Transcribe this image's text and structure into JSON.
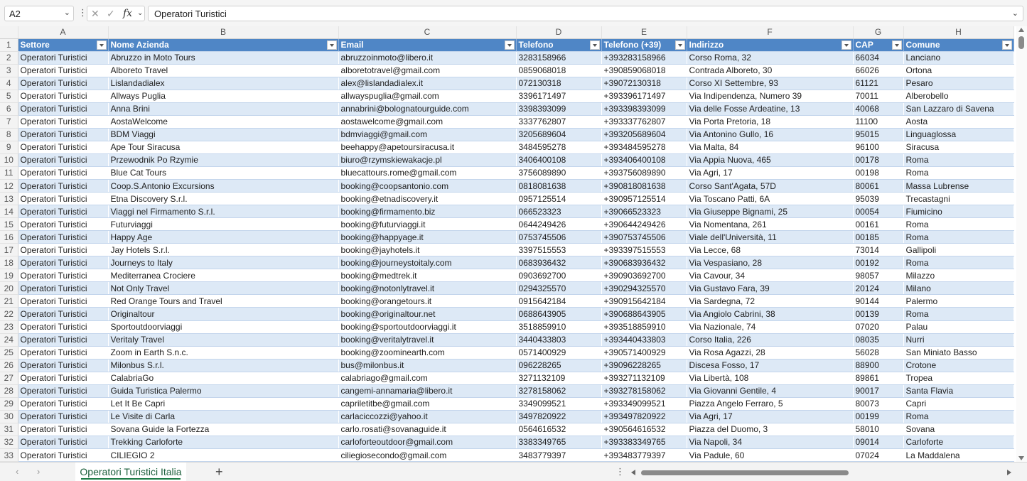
{
  "formula_bar": {
    "name_box": "A2",
    "cancel_icon": "✕",
    "enter_icon": "✓",
    "fx_label": "fx",
    "content": "Operatori Turistici"
  },
  "columns": [
    "A",
    "B",
    "C",
    "D",
    "E",
    "F",
    "G",
    "H"
  ],
  "header_row_number": "1",
  "table_headers": [
    "Settore",
    "Nome Azienda",
    "Email",
    "Telefono",
    "Telefono (+39)",
    "Indirizzo",
    "CAP",
    "Comune"
  ],
  "rows": [
    {
      "n": "2",
      "cells": [
        "Operatori Turistici",
        "Abruzzo in Moto Tours",
        "abruzzoinmoto@libero.it",
        "3283158966",
        "+393283158966",
        "Corso Roma, 32",
        "66034",
        "Lanciano"
      ]
    },
    {
      "n": "3",
      "cells": [
        "Operatori Turistici",
        "Alboreto Travel",
        "alboretotravel@gmail.com",
        "0859068018",
        "+390859068018",
        "Contrada Alboreto, 30",
        "66026",
        "Ortona"
      ]
    },
    {
      "n": "4",
      "cells": [
        "Operatori Turistici",
        "Lislandadialex",
        "alex@lislandadialex.it",
        "072130318",
        "+39072130318",
        "Corso XI Settembre, 93",
        "61121",
        "Pesaro"
      ]
    },
    {
      "n": "5",
      "cells": [
        "Operatori Turistici",
        "Allways Puglia",
        "allwayspuglia@gmail.com",
        "3396171497",
        "+393396171497",
        "Via Indipendenza, Numero 39",
        "70011",
        "Alberobello"
      ]
    },
    {
      "n": "6",
      "cells": [
        "Operatori Turistici",
        "Anna Brini",
        "annabrini@bolognatourguide.com",
        "3398393099",
        "+393398393099",
        "Via delle Fosse Ardeatine, 13",
        "40068",
        "San Lazzaro di Savena"
      ]
    },
    {
      "n": "7",
      "cells": [
        "Operatori Turistici",
        "AostaWelcome",
        "aostawelcome@gmail.com",
        "3337762807",
        "+393337762807",
        "Via Porta Pretoria, 18",
        "11100",
        "Aosta"
      ]
    },
    {
      "n": "8",
      "cells": [
        "Operatori Turistici",
        "BDM Viaggi",
        "bdmviaggi@gmail.com",
        "3205689604",
        "+393205689604",
        "Via Antonino Gullo, 16",
        "95015",
        "Linguaglossa"
      ]
    },
    {
      "n": "9",
      "cells": [
        "Operatori Turistici",
        "Ape Tour Siracusa",
        "beehappy@apetoursiracusa.it",
        "3484595278",
        "+393484595278",
        "Via Malta, 84",
        "96100",
        "Siracusa"
      ]
    },
    {
      "n": "10",
      "cells": [
        "Operatori Turistici",
        "Przewodnik Po Rzymie",
        "biuro@rzymskiewakacje.pl",
        "3406400108",
        "+393406400108",
        "Via Appia Nuova, 465",
        "00178",
        "Roma"
      ]
    },
    {
      "n": "11",
      "cells": [
        "Operatori Turistici",
        "Blue Cat Tours",
        "bluecattours.rome@gmail.com",
        "3756089890",
        "+393756089890",
        "Via Agri, 17",
        "00198",
        "Roma"
      ]
    },
    {
      "n": "12",
      "cells": [
        "Operatori Turistici",
        "Coop.S.Antonio Excursions",
        "booking@coopsantonio.com",
        "0818081638",
        "+390818081638",
        "Corso Sant'Agata, 57D",
        "80061",
        "Massa Lubrense"
      ]
    },
    {
      "n": "13",
      "cells": [
        "Operatori Turistici",
        "Etna Discovery S.r.l.",
        "booking@etnadiscovery.it",
        "0957125514",
        "+390957125514",
        "Via Toscano Patti, 6A",
        "95039",
        "Trecastagni"
      ]
    },
    {
      "n": "14",
      "cells": [
        "Operatori Turistici",
        "Viaggi nel Firmamento S.r.l.",
        "booking@firmamento.biz",
        "066523323",
        "+39066523323",
        "Via Giuseppe Bignami, 25",
        "00054",
        "Fiumicino"
      ]
    },
    {
      "n": "15",
      "cells": [
        "Operatori Turistici",
        "Futurviaggi",
        "booking@futurviaggi.it",
        "0644249426",
        "+390644249426",
        "Via Nomentana, 261",
        "00161",
        "Roma"
      ]
    },
    {
      "n": "16",
      "cells": [
        "Operatori Turistici",
        "Happy Age",
        "booking@happyage.it",
        "0753745506",
        "+390753745506",
        "Viale dell'Università, 11",
        "00185",
        "Roma"
      ]
    },
    {
      "n": "17",
      "cells": [
        "Operatori Turistici",
        "Jay Hotels S.r.l.",
        "booking@jayhotels.it",
        "3397515553",
        "+393397515553",
        "Via Lecce, 68",
        "73014",
        "Gallipoli"
      ]
    },
    {
      "n": "18",
      "cells": [
        "Operatori Turistici",
        "Journeys to Italy",
        "booking@journeystoitaly.com",
        "0683936432",
        "+390683936432",
        "Via Vespasiano, 28",
        "00192",
        "Roma"
      ]
    },
    {
      "n": "19",
      "cells": [
        "Operatori Turistici",
        "Mediterranea Crociere",
        "booking@medtrek.it",
        "0903692700",
        "+390903692700",
        "Via Cavour, 34",
        "98057",
        "Milazzo"
      ]
    },
    {
      "n": "20",
      "cells": [
        "Operatori Turistici",
        "Not Only Travel",
        "booking@notonlytravel.it",
        "0294325570",
        "+390294325570",
        "Via Gustavo Fara, 39",
        "20124",
        "Milano"
      ]
    },
    {
      "n": "21",
      "cells": [
        "Operatori Turistici",
        "Red Orange Tours and Travel",
        "booking@orangetours.it",
        "0915642184",
        "+390915642184",
        "Via Sardegna, 72",
        "90144",
        "Palermo"
      ]
    },
    {
      "n": "22",
      "cells": [
        "Operatori Turistici",
        "Originaltour",
        "booking@originaltour.net",
        "0688643905",
        "+390688643905",
        "Via Angiolo Cabrini, 38",
        "00139",
        "Roma"
      ]
    },
    {
      "n": "23",
      "cells": [
        "Operatori Turistici",
        "Sportoutdoorviaggi",
        "booking@sportoutdoorviaggi.it",
        "3518859910",
        "+393518859910",
        "Via Nazionale, 74",
        "07020",
        "Palau"
      ]
    },
    {
      "n": "24",
      "cells": [
        "Operatori Turistici",
        "Veritaly Travel",
        "booking@veritalytravel.it",
        "3440433803",
        "+393440433803",
        "Corso Italia, 226",
        "08035",
        "Nurri"
      ]
    },
    {
      "n": "25",
      "cells": [
        "Operatori Turistici",
        "Zoom in Earth S.n.c.",
        "booking@zoominearth.com",
        "0571400929",
        "+390571400929",
        "Via Rosa Agazzi, 28",
        "56028",
        "San Miniato Basso"
      ]
    },
    {
      "n": "26",
      "cells": [
        "Operatori Turistici",
        "Milonbus S.r.l.",
        "bus@milonbus.it",
        "096228265",
        "+39096228265",
        "Discesa Fosso, 17",
        "88900",
        "Crotone"
      ]
    },
    {
      "n": "27",
      "cells": [
        "Operatori Turistici",
        "CalabriaGo",
        "calabriago@gmail.com",
        "3271132109",
        "+393271132109",
        "Via Libertà, 108",
        "89861",
        "Tropea"
      ]
    },
    {
      "n": "28",
      "cells": [
        "Operatori Turistici",
        "Guida Turistica Palermo",
        "cangemi-annamaria@libero.it",
        "3278158062",
        "+393278158062",
        "Via Giovanni Gentile, 4",
        "90017",
        "Santa Flavia"
      ]
    },
    {
      "n": "29",
      "cells": [
        "Operatori Turistici",
        "Let It Be Capri",
        "capriletitbe@gmail.com",
        "3349099521",
        "+393349099521",
        "Piazza Angelo Ferraro, 5",
        "80073",
        "Capri"
      ]
    },
    {
      "n": "30",
      "cells": [
        "Operatori Turistici",
        "Le Visite di Carla",
        "carlaciccozzi@yahoo.it",
        "3497820922",
        "+393497820922",
        "Via Agri, 17",
        "00199",
        "Roma"
      ]
    },
    {
      "n": "31",
      "cells": [
        "Operatori Turistici",
        "Sovana Guide la Fortezza",
        "carlo.rosati@sovanaguide.it",
        "0564616532",
        "+390564616532",
        "Piazza del Duomo, 3",
        "58010",
        "Sovana"
      ]
    },
    {
      "n": "32",
      "cells": [
        "Operatori Turistici",
        "Trekking Carloforte",
        "carloforteoutdoor@gmail.com",
        "3383349765",
        "+393383349765",
        "Via Napoli, 34",
        "09014",
        "Carloforte"
      ]
    },
    {
      "n": "33",
      "cells": [
        "Operatori Turistici",
        "CILIEGIO 2",
        "ciliegiosecondo@gmail.com",
        "3483779397",
        "+393483779397",
        "Via Padule, 60",
        "07024",
        "La Maddalena"
      ]
    }
  ],
  "sheet_tabs": [
    "Operatori Turistici Italia"
  ],
  "add_sheet_label": "+",
  "colors": {
    "header_fill": "#4f86c6",
    "band_fill": "#dde9f6",
    "sheet_tab_accent": "#1b7a45"
  },
  "icons": {
    "name_box_dropdown": "chevron-down-icon",
    "cancel": "close-icon",
    "enter": "check-icon",
    "function": "fx-icon",
    "filter": "filter-dropdown-icon",
    "sheet_nav_prev": "chevron-left-icon",
    "sheet_nav_next": "chevron-right-icon",
    "add_sheet": "plus-icon"
  }
}
